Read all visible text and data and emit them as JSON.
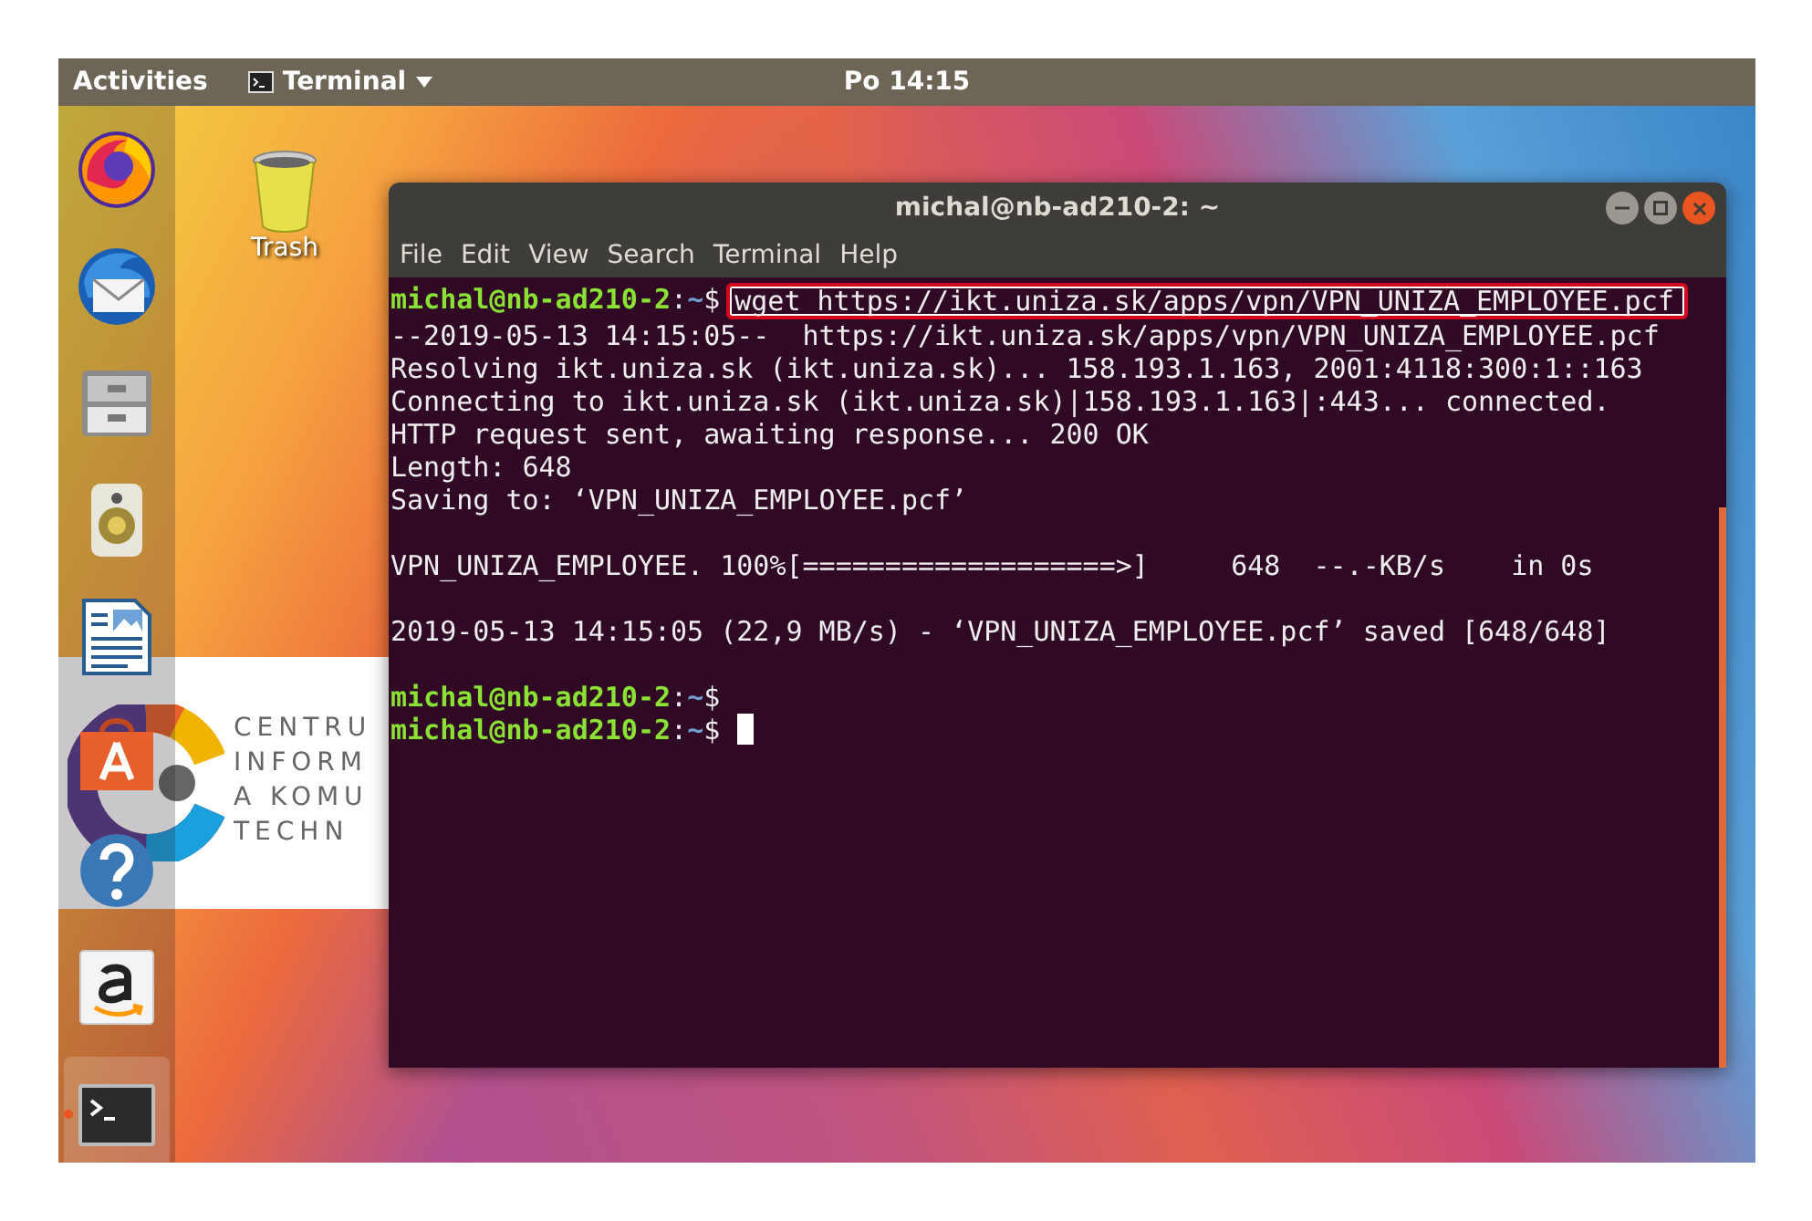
{
  "top_bar": {
    "activities": "Activities",
    "app_menu": "Terminal",
    "clock": "Po 14:15"
  },
  "dock": [
    {
      "kind": "firefox",
      "running": false
    },
    {
      "kind": "mail",
      "running": false
    },
    {
      "kind": "files",
      "running": false
    },
    {
      "kind": "speaker",
      "running": false
    },
    {
      "kind": "document",
      "running": false
    },
    {
      "kind": "store",
      "running": false
    },
    {
      "kind": "help",
      "running": false
    },
    {
      "kind": "amazon",
      "running": false
    },
    {
      "kind": "terminal",
      "running": true
    }
  ],
  "desktop_icons": [
    {
      "label": "Trash"
    }
  ],
  "background_window": {
    "lines": [
      "CENTRU",
      "INFORM",
      "A KOMU",
      "TECHN"
    ]
  },
  "terminal": {
    "title": "michal@nb-ad210-2: ~",
    "menu": [
      "File",
      "Edit",
      "View",
      "Search",
      "Terminal",
      "Help"
    ],
    "lines": [
      {
        "kind": "prompt",
        "user": "michal@nb-ad210-2",
        "colon": ":",
        "dir": "~",
        "sigil": "$",
        "command": "wget https://ikt.uniza.sk/apps/vpn/VPN_UNIZA_EMPLOYEE.pcf",
        "highlighted": true,
        "cursor": false
      },
      {
        "kind": "output",
        "text": "--2019-05-13 14:15:05--  https://ikt.uniza.sk/apps/vpn/VPN_UNIZA_EMPLOYEE.pcf"
      },
      {
        "kind": "output",
        "text": "Resolving ikt.uniza.sk (ikt.uniza.sk)... 158.193.1.163, 2001:4118:300:1::163"
      },
      {
        "kind": "output",
        "text": "Connecting to ikt.uniza.sk (ikt.uniza.sk)|158.193.1.163|:443... connected."
      },
      {
        "kind": "output",
        "text": "HTTP request sent, awaiting response... 200 OK"
      },
      {
        "kind": "output",
        "text": "Length: 648"
      },
      {
        "kind": "output",
        "text": "Saving to: ‘VPN_UNIZA_EMPLOYEE.pcf’"
      },
      {
        "kind": "blank"
      },
      {
        "kind": "output",
        "text": "VPN_UNIZA_EMPLOYEE. 100%[===================>]     648  --.-KB/s    in 0s"
      },
      {
        "kind": "blank"
      },
      {
        "kind": "output",
        "text": "2019-05-13 14:15:05 (22,9 MB/s) - ‘VPN_UNIZA_EMPLOYEE.pcf’ saved [648/648]"
      },
      {
        "kind": "blank"
      },
      {
        "kind": "prompt",
        "user": "michal@nb-ad210-2",
        "colon": ":",
        "dir": "~",
        "sigil": "$",
        "cursor": false
      },
      {
        "kind": "prompt",
        "user": "michal@nb-ad210-2",
        "colon": ":",
        "dir": "~",
        "sigil": "$",
        "cursor": true
      }
    ]
  }
}
